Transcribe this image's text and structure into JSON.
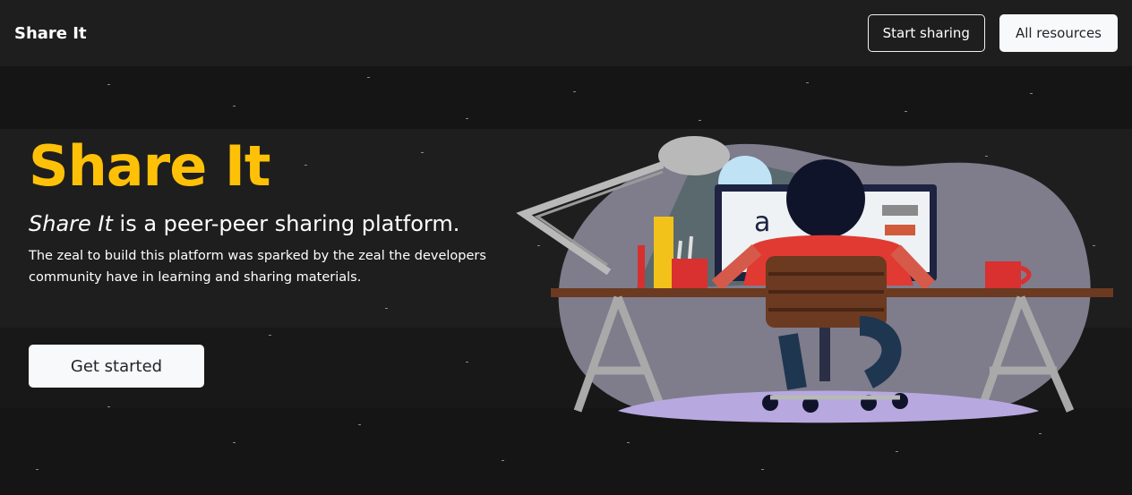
{
  "navbar": {
    "brand": "Share It",
    "start_sharing_label": "Start sharing",
    "all_resources_label": "All resources"
  },
  "hero": {
    "title": "Share It",
    "subtitle_brand": "Share It",
    "subtitle_rest": " is a peer-peer sharing platform.",
    "description": "The zeal to build this platform was sparked by the zeal the developers community have in learning and sharing materials.",
    "cta_label": "Get started"
  },
  "illustration": {
    "screen_letter": "a"
  },
  "colors": {
    "accent": "#ffc107",
    "background": "#1b1b1b",
    "button_light": "#f8f9fa"
  }
}
